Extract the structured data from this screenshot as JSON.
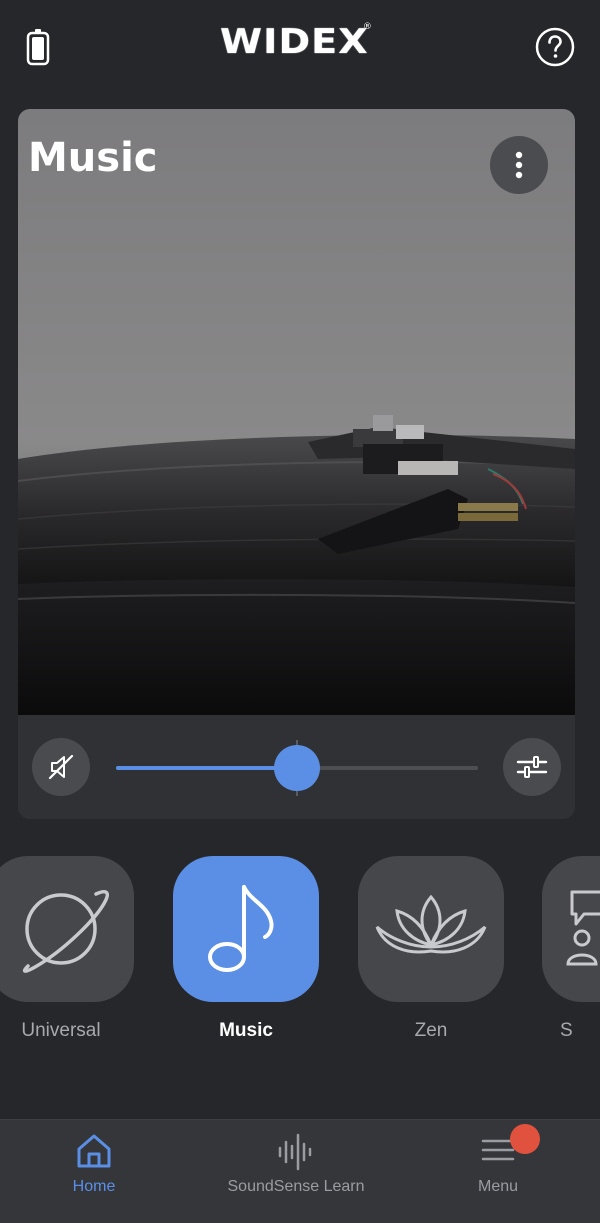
{
  "header": {
    "brand": "WIDEX",
    "brand_mark": "®",
    "battery_icon": "battery-icon",
    "help_icon": "help-icon"
  },
  "program_card": {
    "title": "Music",
    "more_icon": "more-vertical-icon",
    "mute_icon": "mute-icon",
    "adjust_icon": "sliders-icon",
    "volume_level": 0.5
  },
  "programs": [
    {
      "label": "Universal",
      "icon": "planet-icon",
      "active": false
    },
    {
      "label": "Music",
      "icon": "music-note-icon",
      "active": true
    },
    {
      "label": "Zen",
      "icon": "lotus-icon",
      "active": false
    },
    {
      "label": "S",
      "icon": "speech-person-icon",
      "active": false
    }
  ],
  "nav": {
    "home": {
      "label": "Home",
      "icon": "home-icon"
    },
    "soundsense": {
      "label": "SoundSense Learn",
      "icon": "soundwave-icon"
    },
    "menu": {
      "label": "Menu",
      "icon": "menu-icon",
      "badge": true
    }
  },
  "colors": {
    "background": "#26272b",
    "accent": "#5b8fe6",
    "tile": "#46474b",
    "badge": "#e0513e"
  }
}
